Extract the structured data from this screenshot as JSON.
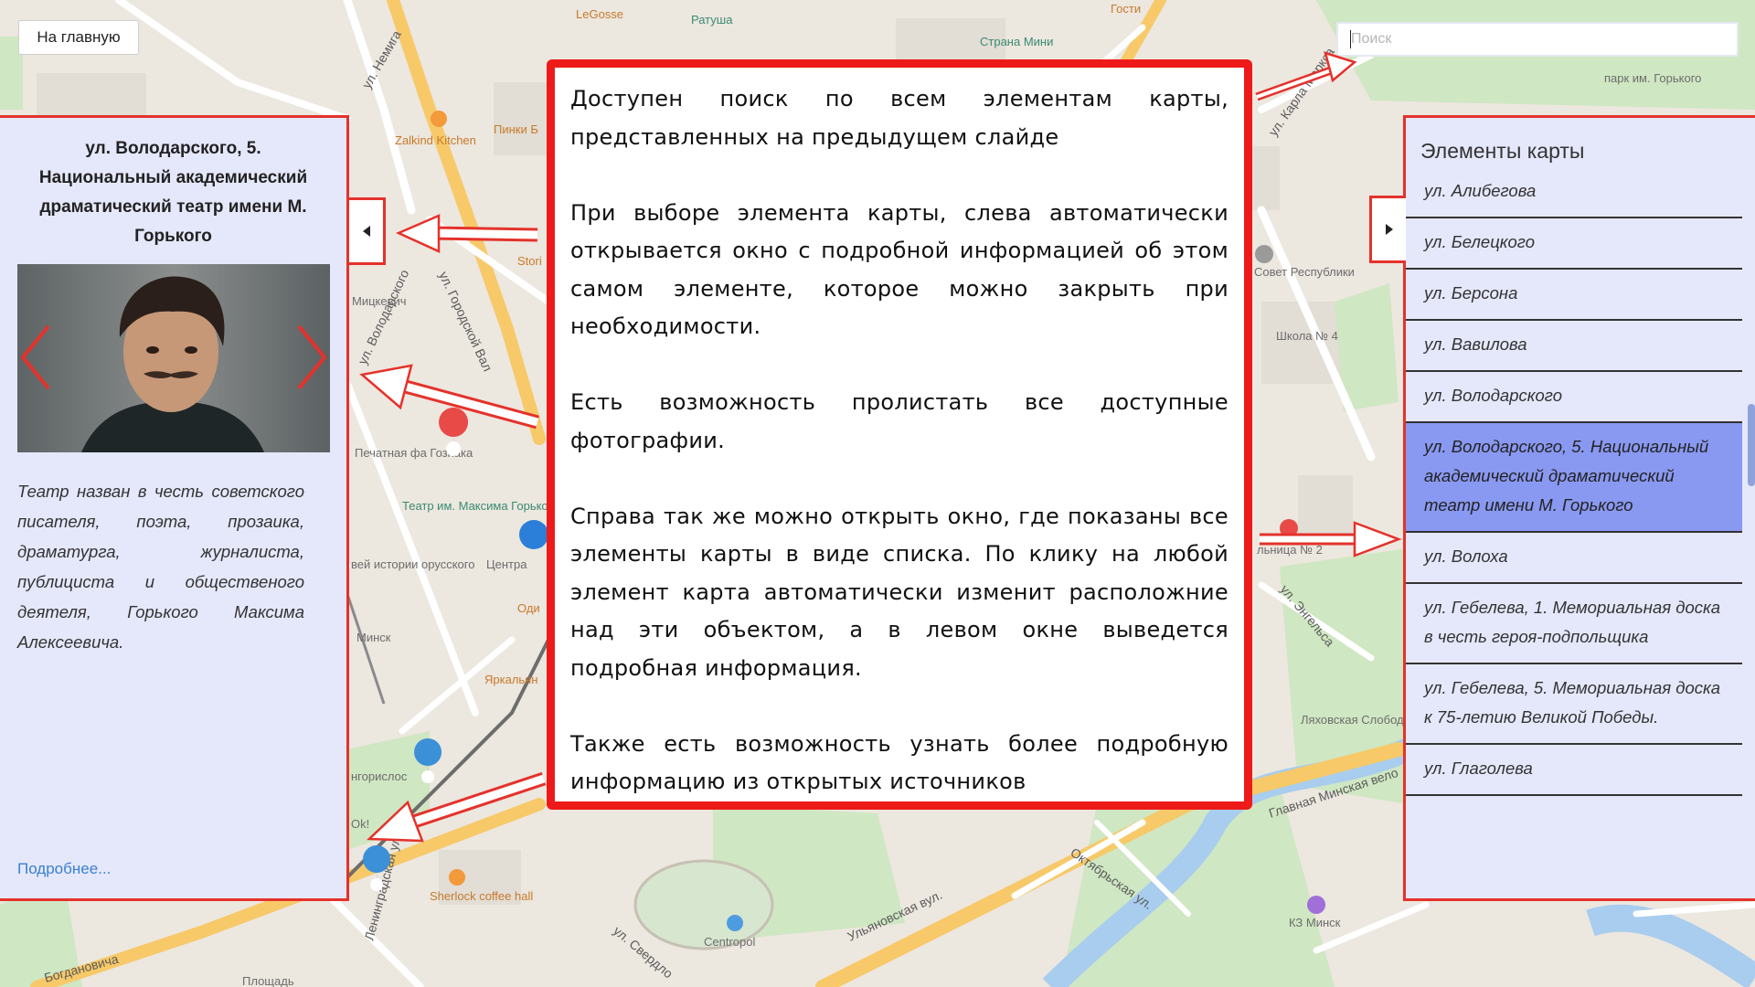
{
  "home_button": {
    "label": "На главную"
  },
  "search": {
    "placeholder": "Поиск",
    "value": ""
  },
  "left_panel": {
    "title": "ул. Володарского, 5. Национальный академический драматический театр имени М. Горького",
    "description": "Театр назван в честь советского писателя, поэта, прозаика, драматурга, журналиста, публициста и общественого деятеля, Горького Максима Алексеевича.",
    "more_link": "Подробнее..."
  },
  "right_panel": {
    "title": "Элементы карты",
    "items": [
      {
        "label": "ул. Алибегова",
        "active": false
      },
      {
        "label": "ул. Белецкого",
        "active": false
      },
      {
        "label": "ул. Берсона",
        "active": false
      },
      {
        "label": "ул. Вавилова",
        "active": false
      },
      {
        "label": "ул. Володарского",
        "active": false
      },
      {
        "label": "ул. Володарского, 5. Национальный академический драматический театр имени М. Горького",
        "active": true
      },
      {
        "label": "ул. Волоха",
        "active": false
      },
      {
        "label": "ул. Гебелева, 1. Мемориальная доска в честь героя-подпольщика",
        "active": false
      },
      {
        "label": "ул. Гебелева, 5. Мемориальная доска к 75-летию Великой Победы.",
        "active": false
      },
      {
        "label": "ул. Глаголева",
        "active": false
      }
    ]
  },
  "info_box": {
    "paragraphs": [
      "Доступен поиск по всем элементам карты, представленных на предыдущем слайде",
      "При выборе элемента карты, слева автоматически открывается окно с подробной информацией об этом самом элементе, которое можно закрыть при необходимости.",
      "Есть возможность пролистать все доступные фотографии.",
      "Справа так же можно открыть окно, где показаны все элементы карты в виде списка. По клику на любой элемент карта автоматически изменит расположние над эти объектом, а в левом окне выведется подробная информация.",
      "Также есть возможность узнать более подробную информацию из открытых источников"
    ]
  },
  "map_labels": {
    "streets": [
      "ул. Немига",
      "ул. Карла Маркса",
      "ул. Городской Вал",
      "ул. Володарского",
      "ул. Энгельса",
      "Главная Минская вело",
      "Ульяновская вул.",
      "ул. Свердло",
      "Ленинградская ул.",
      "Октябрьская ул.",
      "Богдановича"
    ],
    "places": [
      "LeGosse",
      "Ратуша",
      "Страна Мини",
      "Гости",
      "Zalkind Kitchen",
      "Пинки Б",
      "Мицкевич",
      "Печатная фа Гознака",
      "Театр им. Максима Горького",
      "вей истории орусского",
      "Минск",
      "Центра",
      "Оди",
      "Яркальян",
      "Школа № 4",
      "Совет Республики",
      "льница № 2",
      "Ляховская Слобода",
      "парк им. Горького",
      "Sherlock coffee hall",
      "Centropol",
      "КЗ Минск",
      "Площадь",
      "нгорислос",
      "Ok!",
      "Stori"
    ]
  },
  "colors": {
    "accent_red": "#e4322b",
    "panel_bg": "#e5e8fb",
    "active_item": "#8998f0",
    "link": "#3a7fd0"
  },
  "icons": [
    "chevron-left-icon",
    "chevron-right-icon",
    "caret-left-icon",
    "caret-right-icon",
    "map-pin-icon"
  ]
}
